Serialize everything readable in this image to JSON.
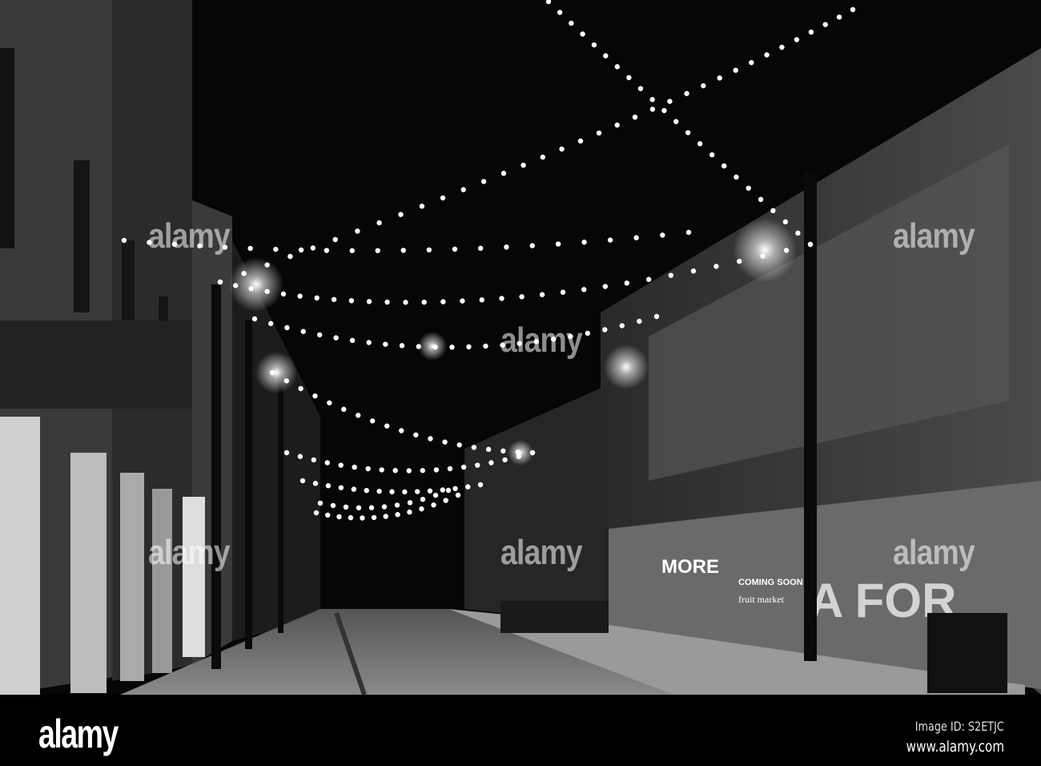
{
  "watermark": {
    "text": "alamy"
  },
  "footer": {
    "logo": "alamy",
    "image_id": "Image ID: S2ETJC",
    "url": "www.alamy.com"
  },
  "signage": {
    "more": "MORE",
    "coming_soon": "COMING SOON",
    "fruit_market": "fruit market",
    "mural_letters": "A FOR"
  }
}
